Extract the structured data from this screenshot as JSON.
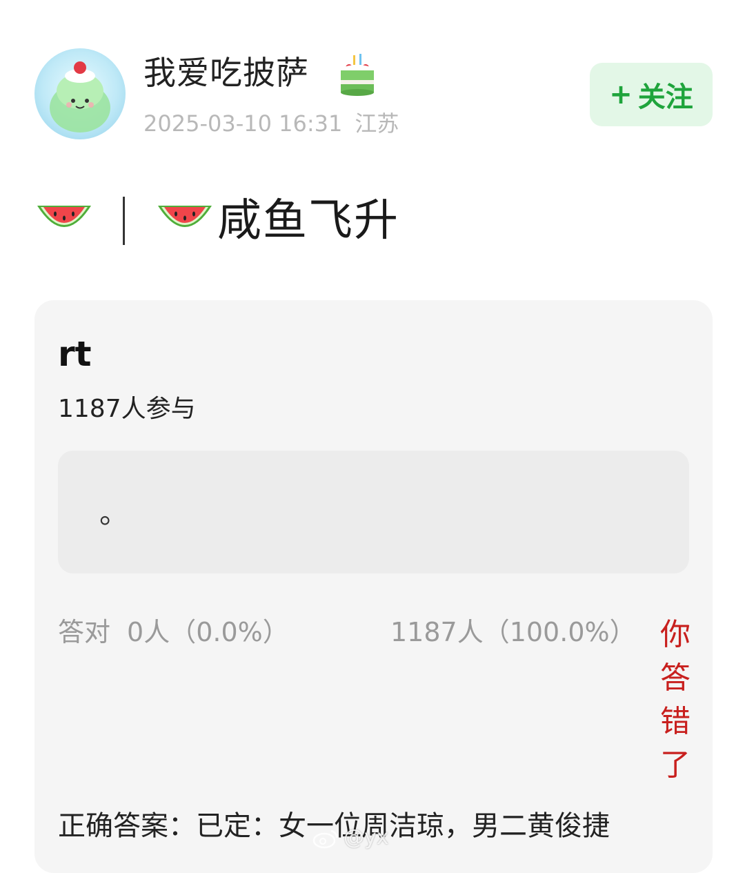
{
  "post": {
    "author": {
      "username": "我爱吃披萨"
    },
    "meta": {
      "timestamp": "2025-03-10 16:31",
      "location": "江苏"
    },
    "follow_button": {
      "label": "关注",
      "icon": "plus-icon"
    },
    "text": "咸鱼飞升",
    "emoji": [
      "watermelon-icon",
      "watermelon-icon"
    ]
  },
  "quiz": {
    "title": "rt",
    "participants": "1187人参与",
    "option_text": "。",
    "correct_label": "答对",
    "correct_count": "0人（0.0%）",
    "wrong_count": "1187人（100.0%）",
    "result_message": "你答错了",
    "answer_text": "正确答案：已定：女一位周洁琼，男二黄俊捷"
  },
  "watermark": {
    "text": "@yx​"
  },
  "colors": {
    "follow_bg": "#e3f7e7",
    "follow_text": "#1fa43c",
    "wrong_red": "#c8201e",
    "card_bg": "#f5f5f5",
    "meta_gray": "#b8b8b8"
  }
}
